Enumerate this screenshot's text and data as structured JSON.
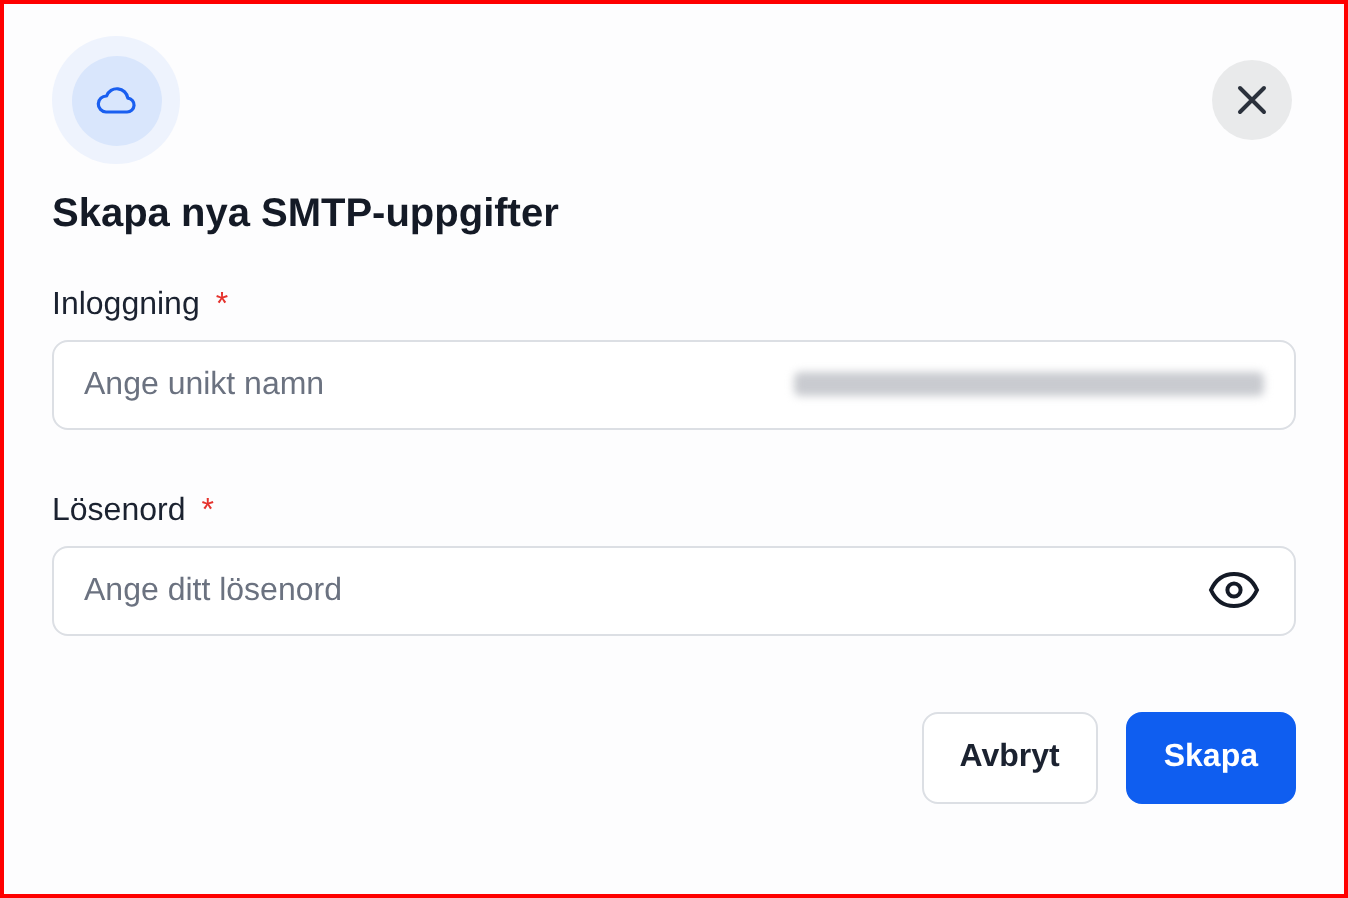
{
  "dialog": {
    "title": "Skapa nya SMTP-uppgifter",
    "fields": [
      {
        "kind": "text",
        "label": "Inloggning",
        "marker": "*",
        "placeholder": "Ange unikt namn",
        "redacted": true
      },
      {
        "kind": "password",
        "label": "Lösenord",
        "marker": "*",
        "placeholder": "Ange ditt lösenord",
        "redacted": false
      }
    ],
    "buttons": [
      {
        "kind": "secondary",
        "label": "Avbryt"
      },
      {
        "kind": "primary",
        "label": "Skapa"
      }
    ]
  }
}
